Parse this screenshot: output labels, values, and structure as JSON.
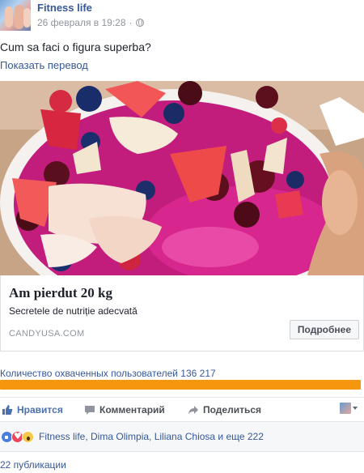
{
  "header": {
    "page_name": "Fitness life",
    "timestamp": "26 февраля в 19:28",
    "separator": "·",
    "privacy_icon": "globe-icon"
  },
  "post": {
    "text": "Cum sa faci o figura superba?",
    "translate_link": "Показать перевод"
  },
  "link_card": {
    "title": "Am pierdut 20 kg",
    "description": "Secretele de nutriție adecvată",
    "domain": "CANDYUSA.COM",
    "button_label": "Подробнее"
  },
  "reach": {
    "label": "Количество охваченных пользователей 136 217",
    "progress_fraction": 1.0,
    "bar_color": "#f5960f"
  },
  "actions": {
    "like_label": "Нравится",
    "comment_label": "Комментарий",
    "share_label": "Поделиться",
    "like_icon": "thumbs-up-icon",
    "comment_icon": "comment-icon",
    "share_icon": "share-arrow-icon"
  },
  "reactions": {
    "icons": [
      "like-reaction-icon",
      "love-reaction-icon",
      "wow-reaction-icon"
    ],
    "summary": "Fitness life, Dima Olimpia, Liliana Chiosa и еще 222"
  },
  "footer": {
    "publications": "22 публикации"
  },
  "colors": {
    "link_blue": "#365899",
    "like_blue": "#4b6fb0",
    "reach_orange": "#f5960f"
  }
}
